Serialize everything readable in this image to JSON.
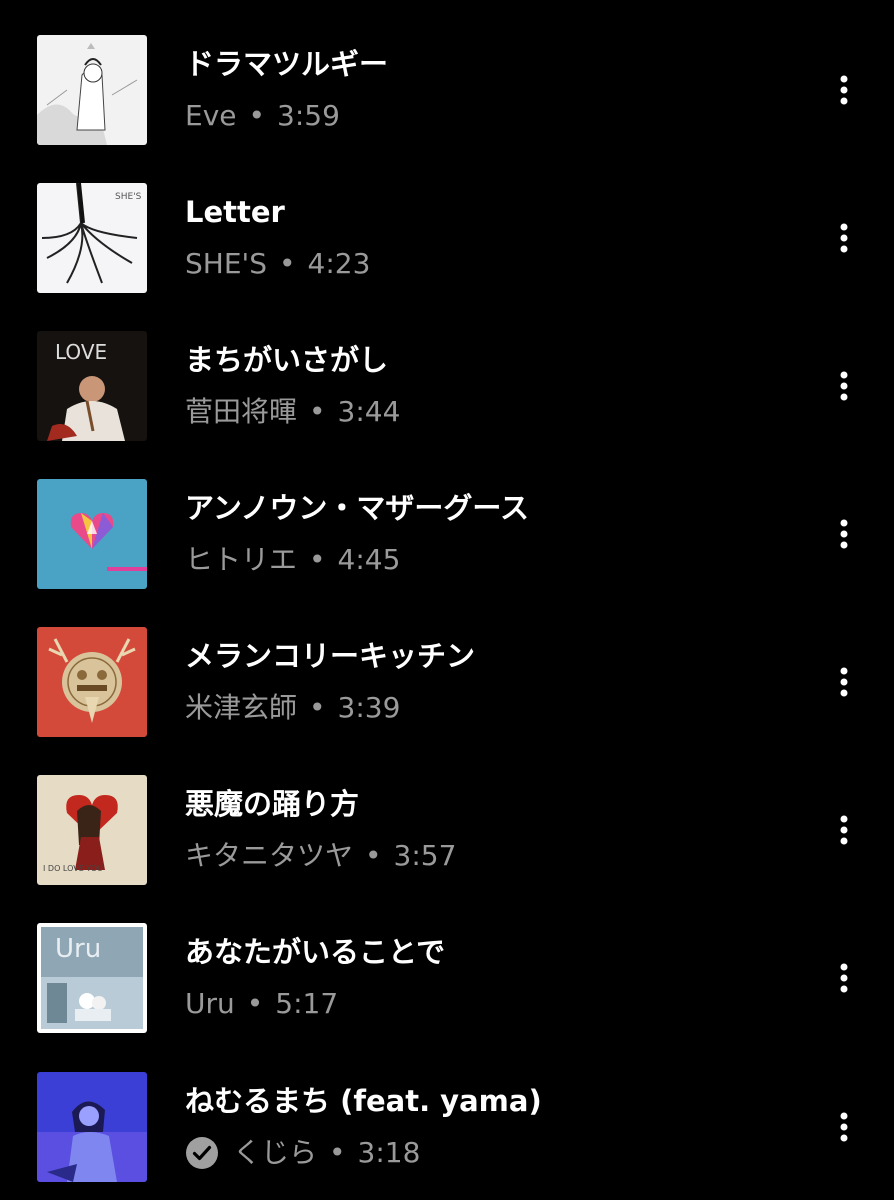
{
  "tracks": [
    {
      "title": "ドラマツルギー",
      "artist": "Eve",
      "separator": "•",
      "duration": "3:59",
      "downloaded": false
    },
    {
      "title": "Letter",
      "artist": "SHE'S",
      "separator": "•",
      "duration": "4:23",
      "downloaded": false
    },
    {
      "title": "まちがいさがし",
      "artist": "菅田将暉",
      "separator": "•",
      "duration": "3:44",
      "downloaded": false
    },
    {
      "title": "アンノウン・マザーグース",
      "artist": "ヒトリエ",
      "separator": "•",
      "duration": "4:45",
      "downloaded": false
    },
    {
      "title": "メランコリーキッチン",
      "artist": "米津玄師",
      "separator": "•",
      "duration": "3:39",
      "downloaded": false
    },
    {
      "title": "悪魔の踊り方",
      "artist": "キタニタツヤ",
      "separator": "•",
      "duration": "3:57",
      "downloaded": false
    },
    {
      "title": "あなたがいることで",
      "artist": "Uru",
      "separator": "•",
      "duration": "5:17",
      "downloaded": false
    },
    {
      "title": "ねむるまち (feat. yama)",
      "artist": "くじら",
      "separator": "•",
      "duration": "3:18",
      "downloaded": true
    }
  ],
  "album_text": {
    "letter_logo": "SHE'S",
    "love_logo": "LOVE",
    "uru_logo": "Uru",
    "kitani_logo": "I DO  LOVE YOU"
  },
  "icons": {
    "more": "more-vertical-icon",
    "downloaded": "check-circle-icon"
  },
  "colors": {
    "background": "#000000",
    "title": "#ffffff",
    "meta": "#9a9a9a"
  }
}
